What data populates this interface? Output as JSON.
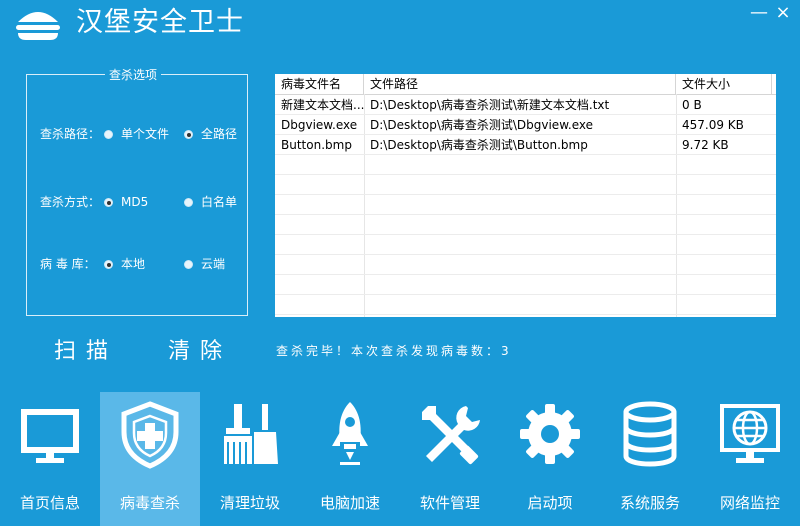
{
  "app": {
    "title": "汉堡安全卫士",
    "minimize": "—",
    "close": "×"
  },
  "options": {
    "legend": "查杀选项",
    "path": {
      "label": "查杀路径：",
      "opt1": "单个文件",
      "opt2": "全路径",
      "selected": 2
    },
    "method": {
      "label": "查杀方式：",
      "opt1": "MD5",
      "opt2": "白名单",
      "selected": 1
    },
    "db": {
      "label": "病 毒 库：",
      "opt1": "本地",
      "opt2": "云端",
      "selected": 1
    }
  },
  "table": {
    "headers": [
      "病毒文件名",
      "文件路径",
      "文件大小"
    ],
    "rows": [
      [
        "新建文本文档....",
        "D:\\Desktop\\病毒查杀测试\\新建文本文档.txt",
        "0 B"
      ],
      [
        "Dbgview.exe",
        "D:\\Desktop\\病毒查杀测试\\Dbgview.exe",
        "457.09 KB"
      ],
      [
        "Button.bmp",
        "D:\\Desktop\\病毒查杀测试\\Button.bmp",
        "9.72 KB"
      ]
    ]
  },
  "actions": {
    "scan": "扫描",
    "clear": "清除"
  },
  "status": "查杀完毕！本次查杀发现病毒数：3",
  "nav": [
    {
      "label": "首页信息",
      "icon": "monitor-icon"
    },
    {
      "label": "病毒查杀",
      "icon": "shield-plus-icon"
    },
    {
      "label": "清理垃圾",
      "icon": "broom-icon"
    },
    {
      "label": "电脑加速",
      "icon": "rocket-icon"
    },
    {
      "label": "软件管理",
      "icon": "tools-icon"
    },
    {
      "label": "启动项",
      "icon": "gear-icon"
    },
    {
      "label": "系统服务",
      "icon": "database-icon"
    },
    {
      "label": "网络监控",
      "icon": "globe-monitor-icon"
    }
  ],
  "active_nav": 1
}
